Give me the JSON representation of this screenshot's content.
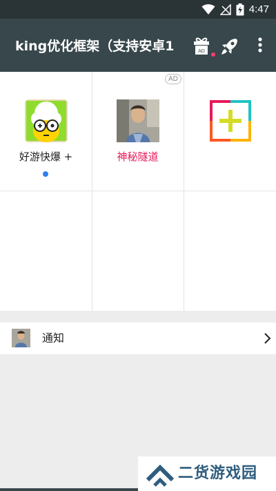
{
  "status_bar": {
    "time": "4:47",
    "icons": [
      "wifi-icon",
      "signal-off-icon",
      "battery-charging-icon"
    ]
  },
  "app_bar": {
    "title": "king优化框架（支持安卓1",
    "gift_icon_label": "AD",
    "icons": [
      "gift-ad-icon",
      "rocket-icon",
      "more-vert-icon"
    ],
    "badge_color": "#ff3d6e"
  },
  "grid": {
    "ad_badge": "AD",
    "items": [
      {
        "label": "好游快爆 +",
        "label_color": "#222222",
        "icon": "haoyou-app-icon",
        "has_dot": true
      },
      {
        "label": "神秘隧道",
        "label_color": "#e8185a",
        "icon": "photo-person-icon"
      },
      {
        "label": "",
        "icon": "add-plus-icon"
      }
    ]
  },
  "notice": {
    "label": "通知",
    "icon": "avatar-icon"
  },
  "watermark": {
    "text": "二货游戏园"
  },
  "colors": {
    "appbar": "#37474b",
    "statusbar": "#2a3336",
    "dot": "#2f80ed"
  }
}
